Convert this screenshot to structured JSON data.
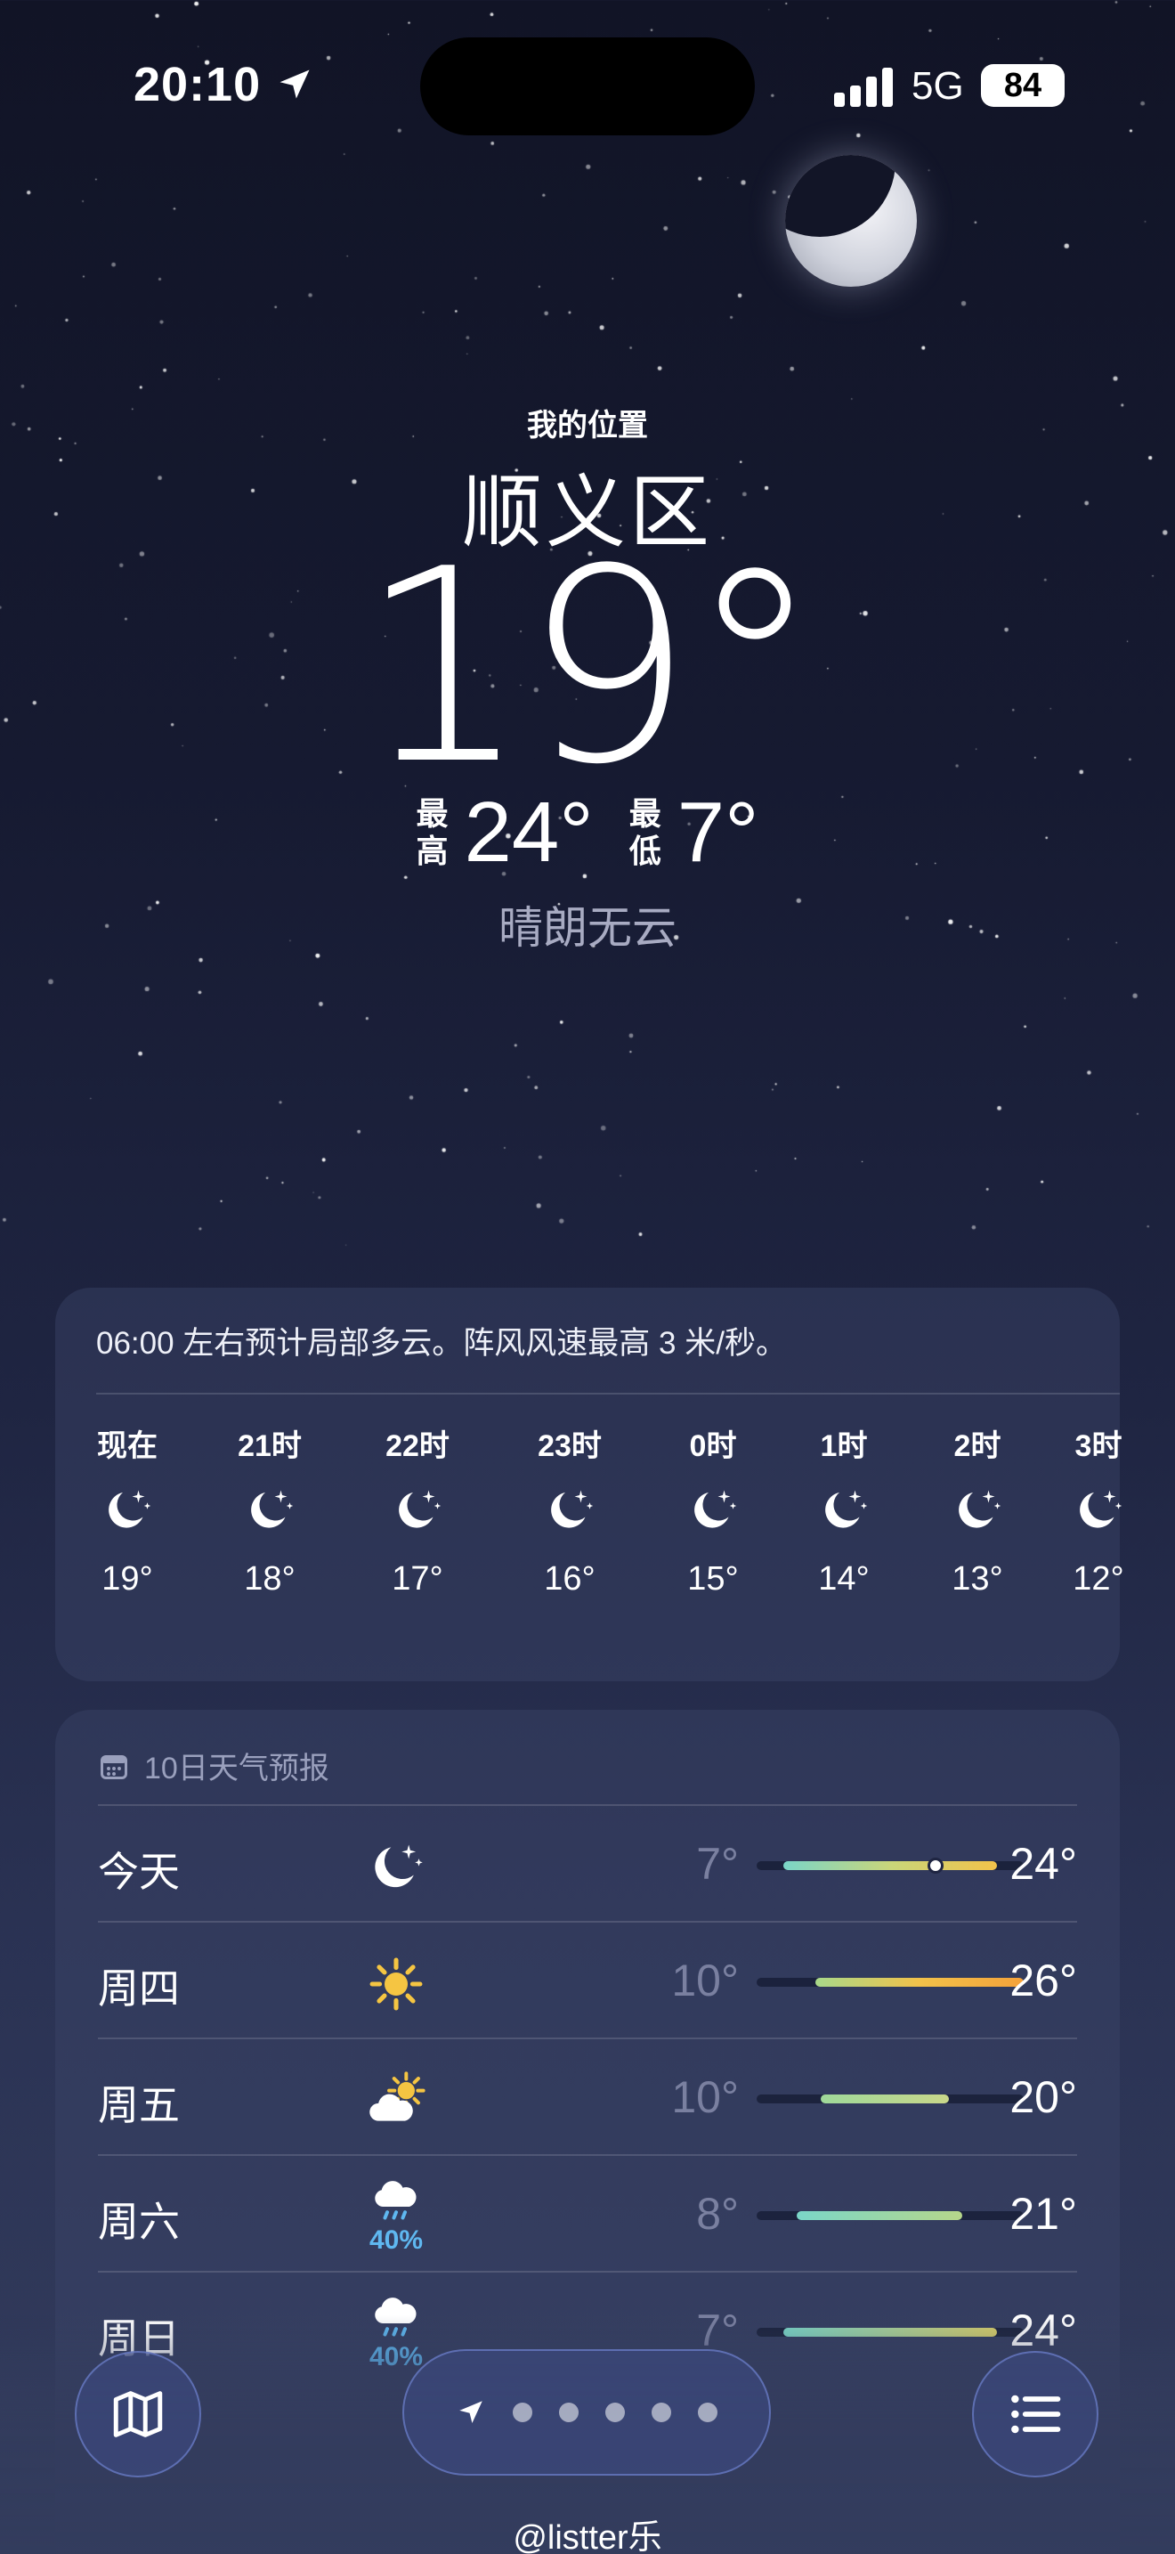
{
  "status_bar": {
    "time": "20:10",
    "network": "5G",
    "battery": "84",
    "location_icon": "location-arrow-icon"
  },
  "location": {
    "label": "我的位置",
    "city": "顺义区"
  },
  "current": {
    "temperature": "19°",
    "high_label": [
      "最",
      "高"
    ],
    "high": "24°",
    "low_label": [
      "最",
      "低"
    ],
    "low": "7°",
    "condition": "晴朗无云"
  },
  "hourly": {
    "summary": "06:00 左右预计局部多云。阵风风速最高 3 米/秒。",
    "icon": "moon-stars-icon",
    "items": [
      {
        "label": "现在",
        "temp": "19°"
      },
      {
        "label": "21时",
        "temp": "18°"
      },
      {
        "label": "22时",
        "temp": "17°"
      },
      {
        "label": "23时",
        "temp": "16°"
      },
      {
        "label": "0时",
        "temp": "15°"
      },
      {
        "label": "1时",
        "temp": "14°"
      },
      {
        "label": "2时",
        "temp": "13°"
      },
      {
        "label": "3时",
        "temp": "12°"
      }
    ]
  },
  "daily": {
    "title": "10日天气预报",
    "items": [
      {
        "day": "今天",
        "icon": "moon-stars-icon",
        "prob": "",
        "low": "7°",
        "high": "24°",
        "range": [
          0.1,
          0.9
        ],
        "current": 0.67,
        "grad": "#7ad6c8,#c9d67a,#f2c24a"
      },
      {
        "day": "周四",
        "icon": "sun-icon",
        "prob": "",
        "low": "10°",
        "high": "26°",
        "range": [
          0.22,
          1.0
        ],
        "current": null,
        "grad": "#a8d98a,#f2c24a,#f5a23a"
      },
      {
        "day": "周五",
        "icon": "partly-sunny-icon",
        "prob": "",
        "low": "10°",
        "high": "20°",
        "range": [
          0.24,
          0.72
        ],
        "current": null,
        "grad": "#9fd99a,#c9d88a"
      },
      {
        "day": "周六",
        "icon": "rain-cloud-icon",
        "prob": "40%",
        "low": "8°",
        "high": "21°",
        "range": [
          0.15,
          0.77
        ],
        "current": null,
        "grad": "#7ad6c8,#b6d68a"
      },
      {
        "day": "周日",
        "icon": "rain-cloud-icon",
        "prob": "40%",
        "low": "7°",
        "high": "24°",
        "range": [
          0.1,
          0.9
        ],
        "current": null,
        "grad": "#7ad6c8,#d8cf6a"
      }
    ]
  },
  "toolbar": {
    "map_icon": "map-icon",
    "list_icon": "list-icon",
    "nav_icon": "location-arrow-icon",
    "page_dots": 5
  },
  "watermark": "@listter乐"
}
